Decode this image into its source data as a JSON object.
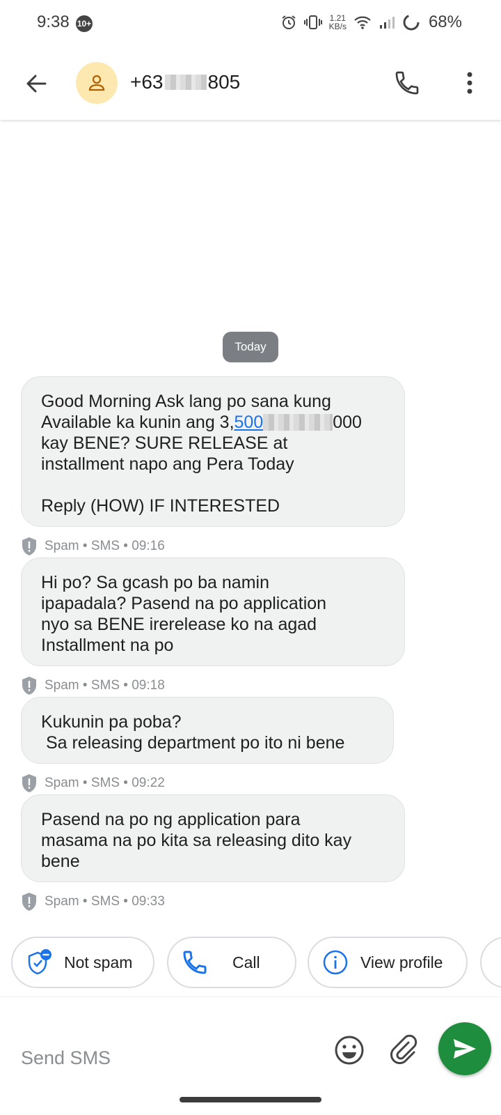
{
  "status_bar": {
    "time": "9:38",
    "notification_count": "10+",
    "net_speed_value": "1.21",
    "net_speed_unit": "KB/s",
    "battery": "68%"
  },
  "app_bar": {
    "contact_prefix": "+63",
    "contact_suffix": "805"
  },
  "conversation": {
    "date_chip": "Today",
    "messages": [
      {
        "text_a": "Good Morning Ask lang po sana kung\nAvailable ka kunin ang 3,",
        "link_start": "500",
        "text_b": "000\nkay BENE? SURE RELEASE at\ninstallment napo ang Pera Today\n\nReply (HOW) IF INTERESTED",
        "meta": "Spam • SMS • 09:16"
      },
      {
        "text": "Hi po? Sa gcash po ba namin\nipapadala? Pasend na po application\nnyo sa BENE irerelease ko na agad\nInstallment na po",
        "meta": "Spam • SMS • 09:18"
      },
      {
        "text": "Kukunin pa poba?\n Sa releasing department po ito ni bene",
        "meta": "Spam • SMS • 09:22"
      },
      {
        "text": "Pasend na po ng application para\nmasama na po kita sa releasing dito kay\nbene",
        "meta": "Spam • SMS • 09:33"
      }
    ]
  },
  "suggestions": {
    "not_spam": "Not spam",
    "call": "Call",
    "view_profile": "View profile"
  },
  "compose": {
    "placeholder": "Send SMS"
  },
  "colors": {
    "bubble": "#f0f1f1",
    "date_chip": "#7b7f84",
    "link": "#1a73e8",
    "send": "#1e8e3e",
    "avatar": "#fde8b0",
    "chip_icon": "#1a73e8"
  }
}
